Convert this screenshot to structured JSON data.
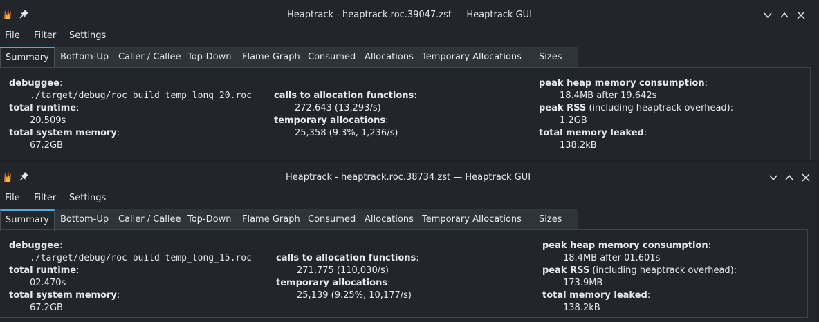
{
  "menu": [
    "File",
    "Filter",
    "Settings"
  ],
  "tabs": [
    "Summary",
    "Bottom-Up",
    "Caller / Callee",
    "Top-Down",
    "Flame Graph",
    "Consumed",
    "Allocations",
    "Temporary Allocations",
    "Sizes"
  ],
  "windows": [
    {
      "title": "Heaptrack - heaptrack.roc.39047.zst — Heaptrack GUI",
      "debuggee_label": "debuggee",
      "debuggee": "./target/debug/roc build temp_long_20.roc",
      "total_runtime_label": "total runtime",
      "total_runtime": "20.509s",
      "total_system_memory_label": "total system memory",
      "total_system_memory": "67.2GB",
      "calls_label": "calls to allocation functions",
      "calls": "272,643 (13,293/s)",
      "temp_label": "temporary allocations",
      "temp": "25,358 (9.3%, 1,236/s)",
      "peak_heap_label": "peak heap memory consumption",
      "peak_heap": "18.4MB after 19.642s",
      "peak_rss_label": "peak RSS",
      "peak_rss_note": "(including heaptrack overhead)",
      "peak_rss": "1.2GB",
      "leaked_label": "total memory leaked",
      "leaked": "138.2kB"
    },
    {
      "title": "Heaptrack - heaptrack.roc.38734.zst — Heaptrack GUI",
      "debuggee_label": "debuggee",
      "debuggee": "./target/debug/roc build temp_long_15.roc",
      "total_runtime_label": "total runtime",
      "total_runtime": "02.470s",
      "total_system_memory_label": "total system memory",
      "total_system_memory": "67.2GB",
      "calls_label": "calls to allocation functions",
      "calls": "271,775 (110,030/s)",
      "temp_label": "temporary allocations",
      "temp": "25,139 (9.25%, 10,177/s)",
      "peak_heap_label": "peak heap memory consumption",
      "peak_heap": "18.4MB after 01.601s",
      "peak_rss_label": "peak RSS",
      "peak_rss_note": "(including heaptrack overhead)",
      "peak_rss": "173.9MB",
      "leaked_label": "total memory leaked",
      "leaked": "138.2kB"
    }
  ],
  "colors": {
    "accent": "#3daee9",
    "background": "#22262b",
    "tabbar": "#2f343a",
    "text": "#e7e9ec"
  }
}
